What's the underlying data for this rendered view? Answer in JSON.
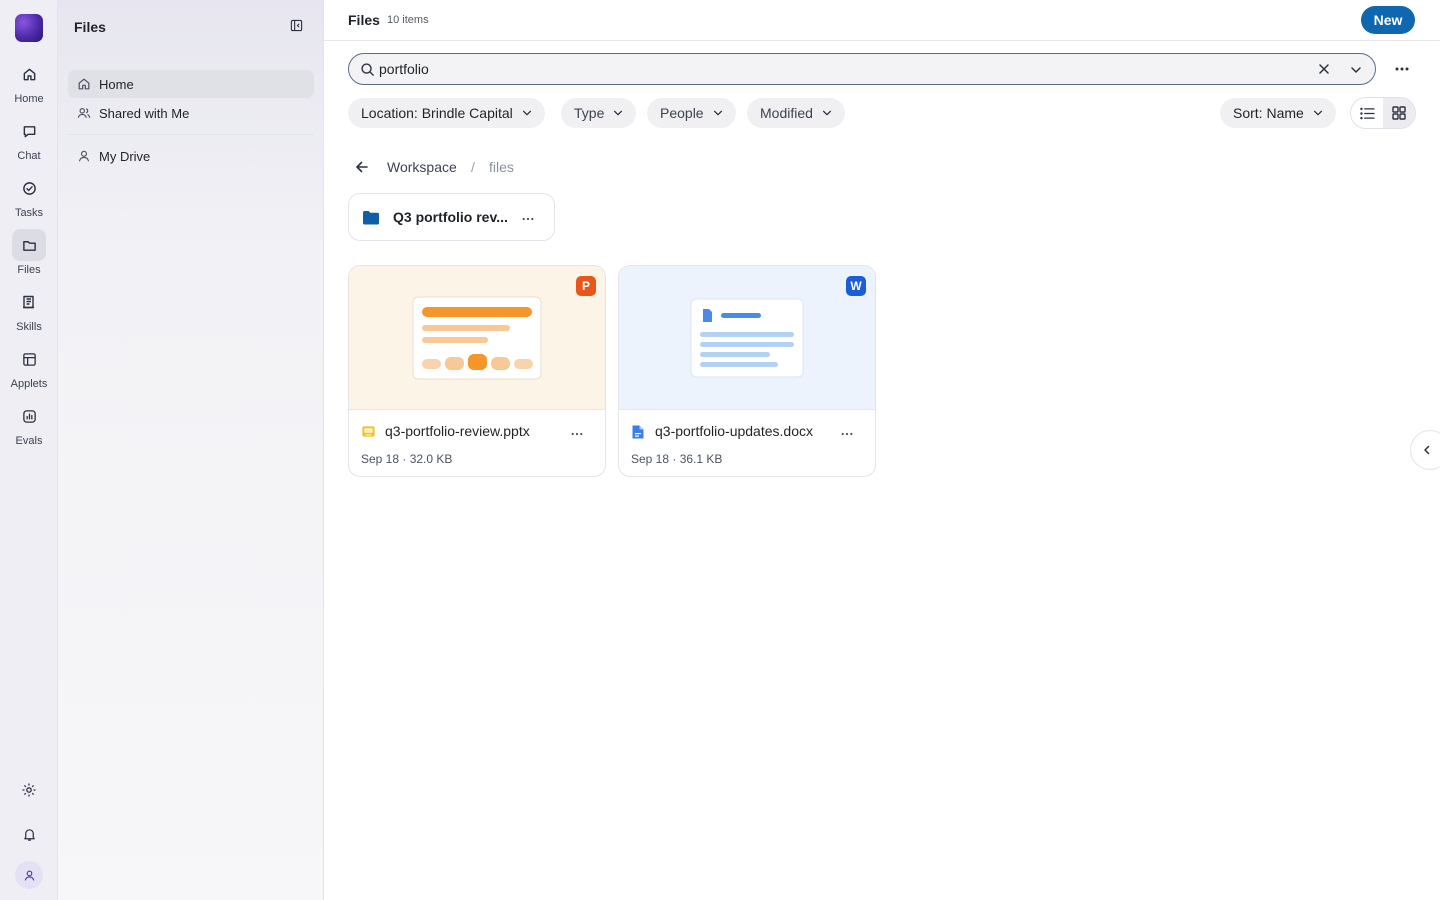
{
  "rail": {
    "items": [
      {
        "label": "Home",
        "icon": "home-icon"
      },
      {
        "label": "Chat",
        "icon": "chat-icon"
      },
      {
        "label": "Tasks",
        "icon": "tasks-icon"
      },
      {
        "label": "Files",
        "icon": "folder-icon",
        "active": true
      },
      {
        "label": "Skills",
        "icon": "skills-icon"
      },
      {
        "label": "Applets",
        "icon": "applets-icon"
      },
      {
        "label": "Evals",
        "icon": "evals-icon"
      }
    ],
    "bottom": [
      "settings-icon",
      "bell-icon",
      "user-icon"
    ]
  },
  "sidepanel": {
    "title": "Files",
    "items": [
      {
        "label": "Home",
        "icon": "home-icon",
        "active": true
      },
      {
        "label": "Shared with Me",
        "icon": "people-icon"
      },
      {
        "label": "My Drive",
        "icon": "person-icon"
      }
    ]
  },
  "header": {
    "title": "Files",
    "count": "10 items",
    "new_label": "New"
  },
  "search": {
    "value": "portfolio"
  },
  "filters": {
    "location": "Location: Brindle Capital",
    "type": "Type",
    "people": "People",
    "modified": "Modified",
    "sort": "Sort: Name"
  },
  "breadcrumb": {
    "root": "Workspace",
    "separator": "/",
    "current": "files"
  },
  "folders": [
    {
      "name": "Q3 portfolio rev..."
    }
  ],
  "files": [
    {
      "name": "q3-portfolio-review.pptx",
      "meta": "Sep 18 · 32.0 KB",
      "badge": "P",
      "badge_color": "#e8561a",
      "kind": "presentation"
    },
    {
      "name": "q3-portfolio-updates.docx",
      "meta": "Sep 18 · 36.1 KB",
      "badge": "W",
      "badge_color": "#1a5fd6",
      "kind": "document"
    }
  ],
  "colors": {
    "accent": "#0f67b0",
    "pptx_orange": "#f4962a",
    "docx_blue": "#4a8ae8"
  }
}
